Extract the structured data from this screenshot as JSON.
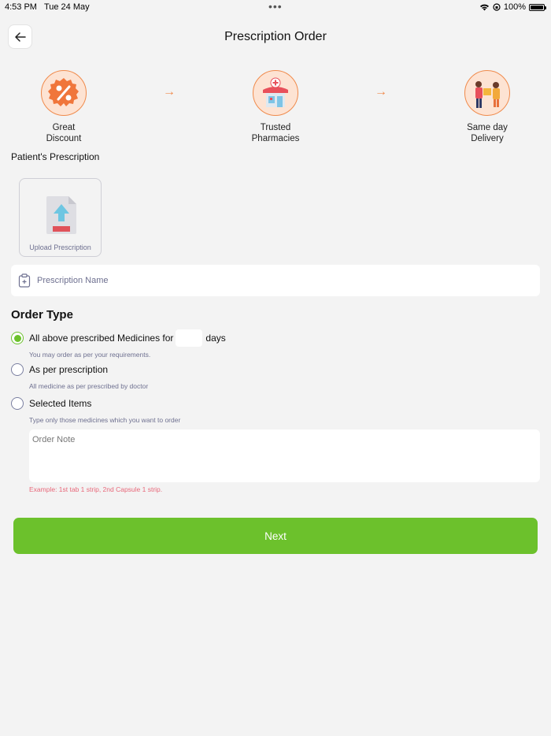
{
  "status_bar": {
    "time": "4:53 PM",
    "date": "Tue 24 May",
    "dots": "•••",
    "battery": "100%"
  },
  "header": {
    "title": "Prescription Order"
  },
  "features": [
    {
      "label": "Great\nDiscount",
      "icon": "discount-icon"
    },
    {
      "label": "Trusted\nPharmacies",
      "icon": "pharmacy-icon"
    },
    {
      "label": "Same day\nDelivery",
      "icon": "delivery-icon"
    }
  ],
  "prescription": {
    "section_label": "Patient's Prescription",
    "upload_label": "Upload Prescription",
    "name_placeholder": "Prescription Name"
  },
  "order_type": {
    "title": "Order Type",
    "options": [
      {
        "label_before": "All above prescribed Medicines for",
        "label_after": "days",
        "hint": "You may order as per your requirements.",
        "selected": true
      },
      {
        "label": "As per prescription",
        "hint": "All medicine as per prescribed by doctor",
        "selected": false
      },
      {
        "label": "Selected Items",
        "hint": "Type only those medicines which you want to order",
        "selected": false
      }
    ],
    "days_value": "",
    "note_placeholder": "Order Note",
    "example": "Example: 1st tab 1 strip, 2nd Capsule 1 strip."
  },
  "footer": {
    "next_label": "Next"
  },
  "colors": {
    "accent_green": "#6cc12c",
    "accent_orange": "#f08a4b",
    "hint_color": "#6e7090",
    "example_color": "#e8687a"
  }
}
